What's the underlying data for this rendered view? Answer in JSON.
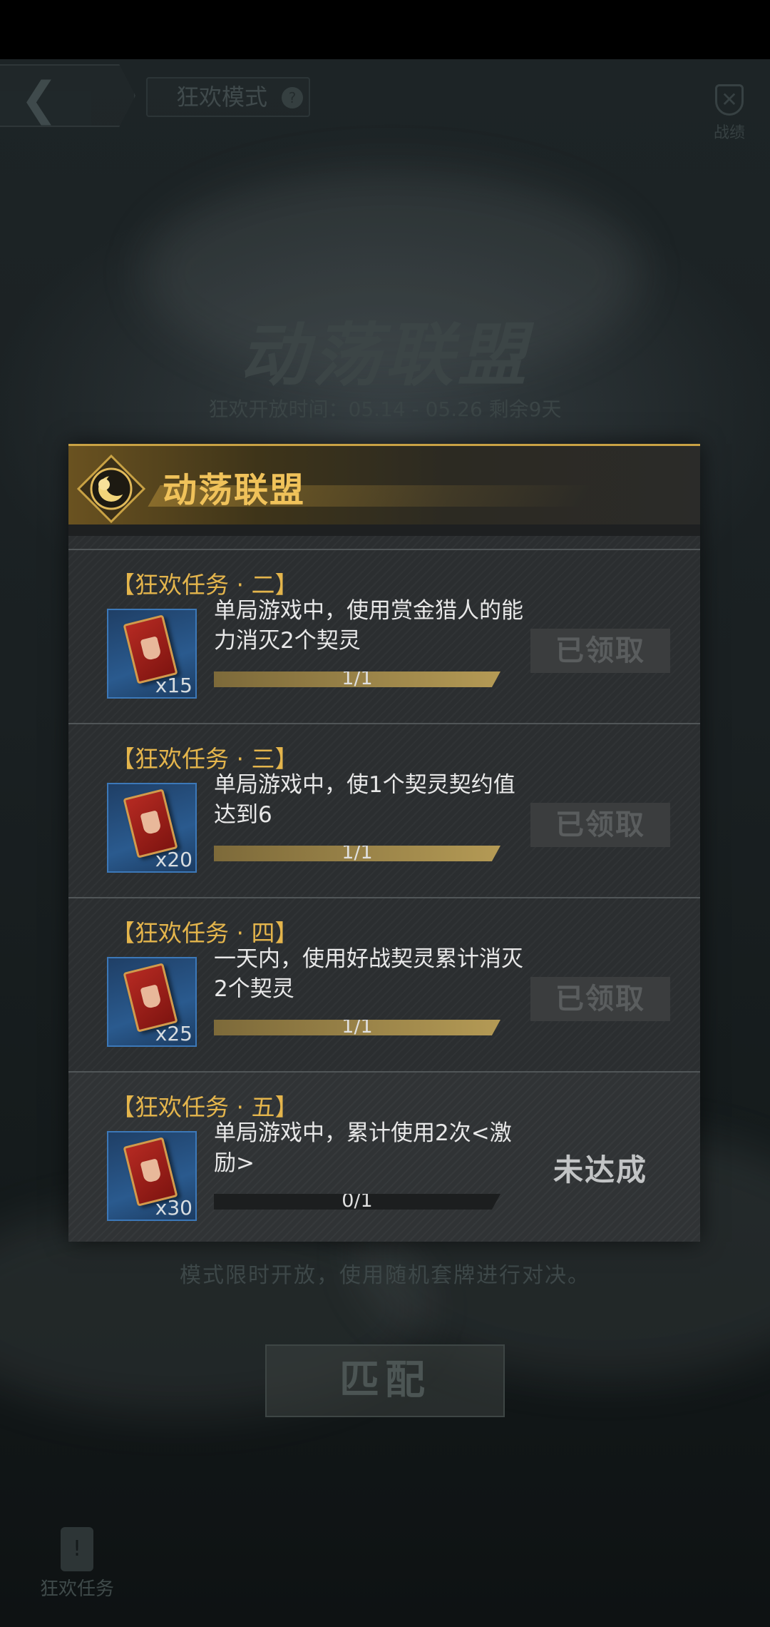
{
  "background": {
    "mode_tab": "狂欢模式",
    "record_label": "战绩",
    "title": "动荡联盟",
    "time_text": "狂欢开放时间：05.14 - 05.26   剩余9天",
    "description": "模式限时开放，使用随机套牌进行对决。",
    "match_button": "匹配",
    "carnival_tasks_label": "狂欢任务"
  },
  "popup": {
    "title": "动荡联盟",
    "tasks": [
      {
        "title": "【狂欢任务 · 二】",
        "desc": "单局游戏中，使用赏金猎人的能力消灭2个契灵",
        "reward_count": "x15",
        "progress_text": "1/1",
        "progress": 1.0,
        "status": "已领取"
      },
      {
        "title": "【狂欢任务 · 三】",
        "desc": "单局游戏中，使1个契灵契约值达到6",
        "reward_count": "x20",
        "progress_text": "1/1",
        "progress": 1.0,
        "status": "已领取"
      },
      {
        "title": "【狂欢任务 · 四】",
        "desc": "一天内，使用好战契灵累计消灭2个契灵",
        "reward_count": "x25",
        "progress_text": "1/1",
        "progress": 1.0,
        "status": "已领取"
      },
      {
        "title": "【狂欢任务 · 五】",
        "desc": "单局游戏中，累计使用2次<激励>",
        "reward_count": "x30",
        "progress_text": "0/1",
        "progress": 0.0,
        "status": "未达成"
      }
    ]
  },
  "colors": {
    "gold": "#e4b54c",
    "header_gold": "#f0c25a",
    "reward_frame_blue": "#3c78b8"
  }
}
